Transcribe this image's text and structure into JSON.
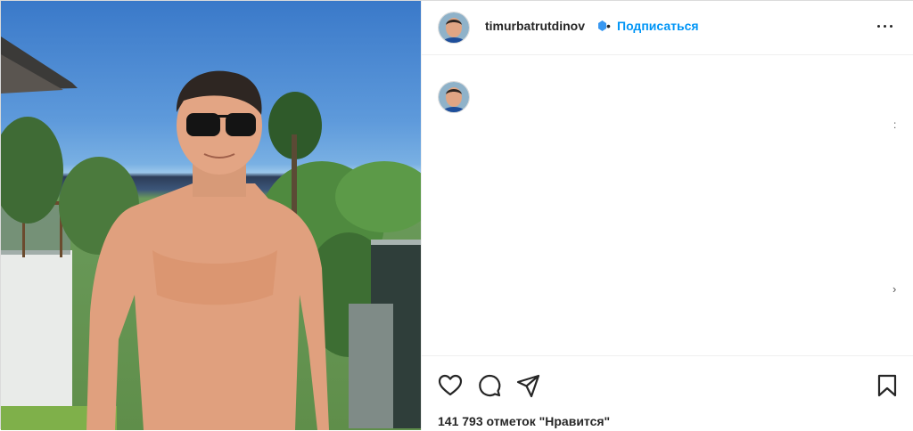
{
  "post": {
    "username": "timurbatrutdinov",
    "separator": "•",
    "follow_label": "Подписаться",
    "likes_text": "141 793 отметок \"Нравится\""
  },
  "icons": {
    "more": "more-options-icon",
    "like": "heart-icon",
    "comment": "comment-icon",
    "share": "paper-plane-icon",
    "save": "bookmark-icon",
    "verified": "verified-badge-icon"
  },
  "colors": {
    "follow": "#0095f6",
    "text": "#262626",
    "border": "#dbdbdb"
  },
  "panel": {
    "marker_top": ":",
    "marker_bottom": "›"
  }
}
